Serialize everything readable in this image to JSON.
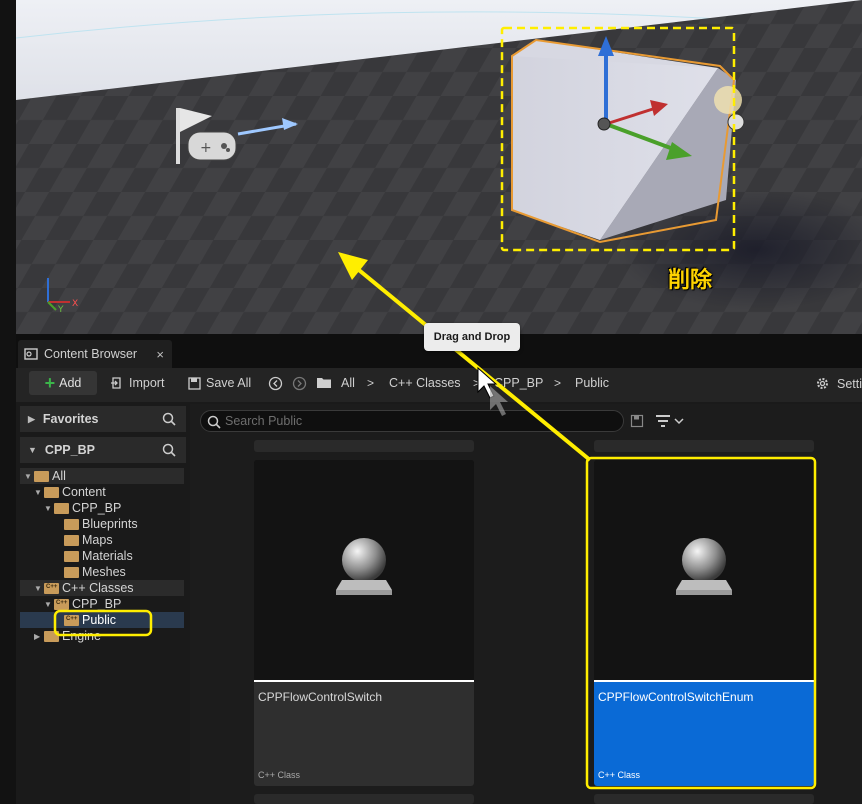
{
  "viewport": {
    "annotation_label": "削除",
    "tooltip": "Drag and Drop"
  },
  "tab": {
    "label": "Content Browser",
    "close": "×"
  },
  "toolbar": {
    "add_label": "Add",
    "import_label": "Import",
    "save_all_label": "Save All",
    "settings_label": "Setti",
    "breadcrumb": [
      "All",
      "C++ Classes",
      "CPP_BP",
      "Public"
    ]
  },
  "sidebar": {
    "favorites": "Favorites",
    "project": "CPP_BP",
    "tree": [
      {
        "label": "All"
      },
      {
        "label": "Content"
      },
      {
        "label": "CPP_BP"
      },
      {
        "label": "Blueprints"
      },
      {
        "label": "Maps"
      },
      {
        "label": "Materials"
      },
      {
        "label": "Meshes"
      },
      {
        "label": "C++ Classes"
      },
      {
        "label": "CPP_BP"
      },
      {
        "label": "Public"
      },
      {
        "label": "Engine"
      }
    ]
  },
  "search": {
    "placeholder": "Search Public"
  },
  "assets": [
    {
      "name": "CPPFlowControlSwitch",
      "kind": "C++ Class",
      "selected": false
    },
    {
      "name": "CPPFlowControlSwitchEnum",
      "kind": "C++ Class",
      "selected": true
    }
  ],
  "colors": {
    "accent": "#0a6ad6",
    "annotation": "#ffd400",
    "add_icon": "#3bb54a"
  }
}
